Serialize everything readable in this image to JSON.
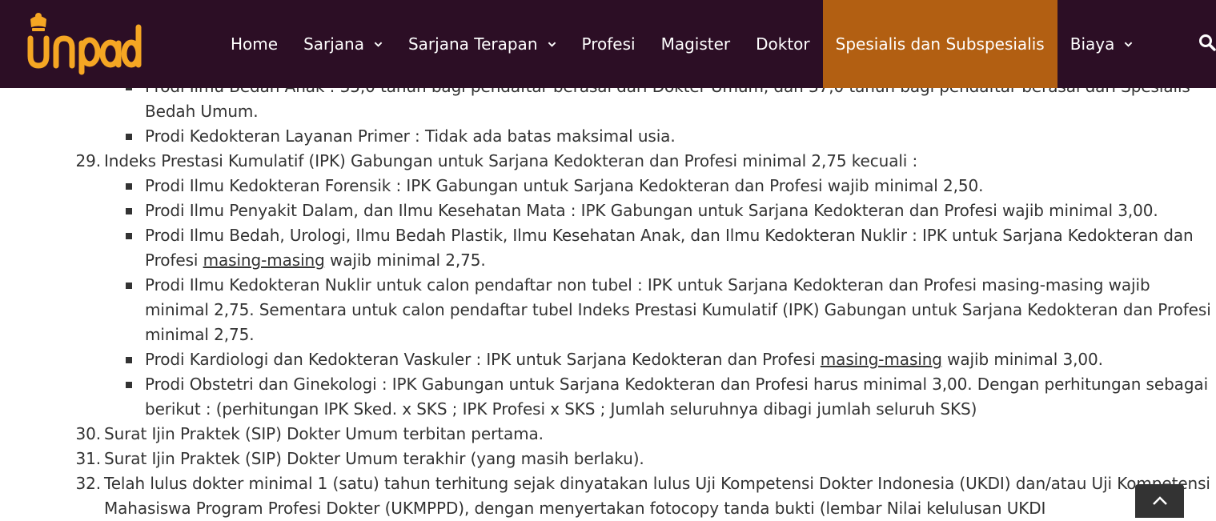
{
  "colors": {
    "header_bg": "#2c0e25",
    "active_bg": "#b25f12",
    "logo": "#f5a623",
    "text": "#333333"
  },
  "logo": {
    "text": "unpad"
  },
  "nav": {
    "items": [
      {
        "label": "Home"
      },
      {
        "label": "Sarjana"
      },
      {
        "label": "Sarjana Terapan"
      },
      {
        "label": "Profesi"
      },
      {
        "label": "Magister"
      },
      {
        "label": "Doktor"
      },
      {
        "label": "Spesialis dan Subspesialis"
      },
      {
        "label": "Biaya"
      }
    ],
    "active_index": 6,
    "search_icon": "search-icon"
  },
  "content": {
    "prev_item": {
      "bullets": [
        {
          "text": "Prodi Ilmu Bedah Anak : 35,0 tahun bagi pendaftar berasal dari Dokter Umum, dan 37,0 tahun bagi pendaftar berasal dari Spesialis Bedah Umum."
        },
        {
          "text": "Prodi Kedokteran Layanan Primer : Tidak ada batas maksimal usia."
        }
      ]
    },
    "item29": {
      "num": "29.",
      "text": "Indeks Prestasi Kumulatif (IPK) Gabungan untuk Sarjana Kedokteran dan Profesi minimal 2,75 kecuali :",
      "bullets": [
        {
          "text": "Prodi Ilmu Kedokteran Forensik : IPK Gabungan untuk Sarjana Kedokteran dan Profesi wajib minimal 2,50."
        },
        {
          "text": "Prodi Ilmu Penyakit Dalam, dan Ilmu Kesehatan Mata : IPK Gabungan untuk Sarjana Kedokteran dan Profesi wajib minimal 3,00."
        },
        {
          "a": "Prodi Ilmu Bedah, Urologi, Ilmu Bedah Plastik, Ilmu Kesehatan Anak, dan Ilmu Kedokteran Nuklir : IPK untuk Sarjana Kedokteran dan Profesi ",
          "u": "masing-masing",
          "b": " wajib minimal 2,75."
        },
        {
          "text": "Prodi Ilmu Kedokteran Nuklir untuk calon pendaftar non tubel : IPK untuk Sarjana Kedokteran dan Profesi masing-masing wajib minimal 2,75. Sementara untuk calon pendaftar tubel Indeks Prestasi Kumulatif (IPK) Gabungan untuk Sarjana Kedokteran dan Profesi minimal 2,75."
        },
        {
          "a": "Prodi Kardiologi dan Kedokteran Vaskuler : IPK untuk Sarjana Kedokteran dan Profesi ",
          "u": "masing-masing",
          "b": " wajib minimal 3,00."
        },
        {
          "text": "Prodi Obstetri dan Ginekologi : IPK Gabungan untuk Sarjana Kedokteran dan Profesi harus minimal 3,00. Dengan perhitungan sebagai berikut : (perhitungan IPK Sked. x SKS ; IPK Profesi x SKS ; Jumlah seluruhnya dibagi jumlah seluruh SKS)"
        }
      ]
    },
    "item30": {
      "num": "30.",
      "text": "Surat Ijin Praktek (SIP) Dokter Umum terbitan pertama."
    },
    "item31": {
      "num": "31.",
      "text": "Surat Ijin Praktek (SIP) Dokter Umum terakhir (yang masih berlaku)."
    },
    "item32": {
      "num": "32.",
      "text": "Telah lulus dokter minimal 1 (satu) tahun terhitung sejak dinyatakan lulus Uji Kompetensi Dokter Indonesia (UKDI) dan/atau Uji Kompetensi Mahasiswa Program Profesi Dokter (UKMPPD), dengan menyertakan fotocopy tanda bukti (lembar Nilai kelulusan UKDI"
    }
  },
  "scroll_top": {
    "icon": "chevron-up-icon"
  }
}
